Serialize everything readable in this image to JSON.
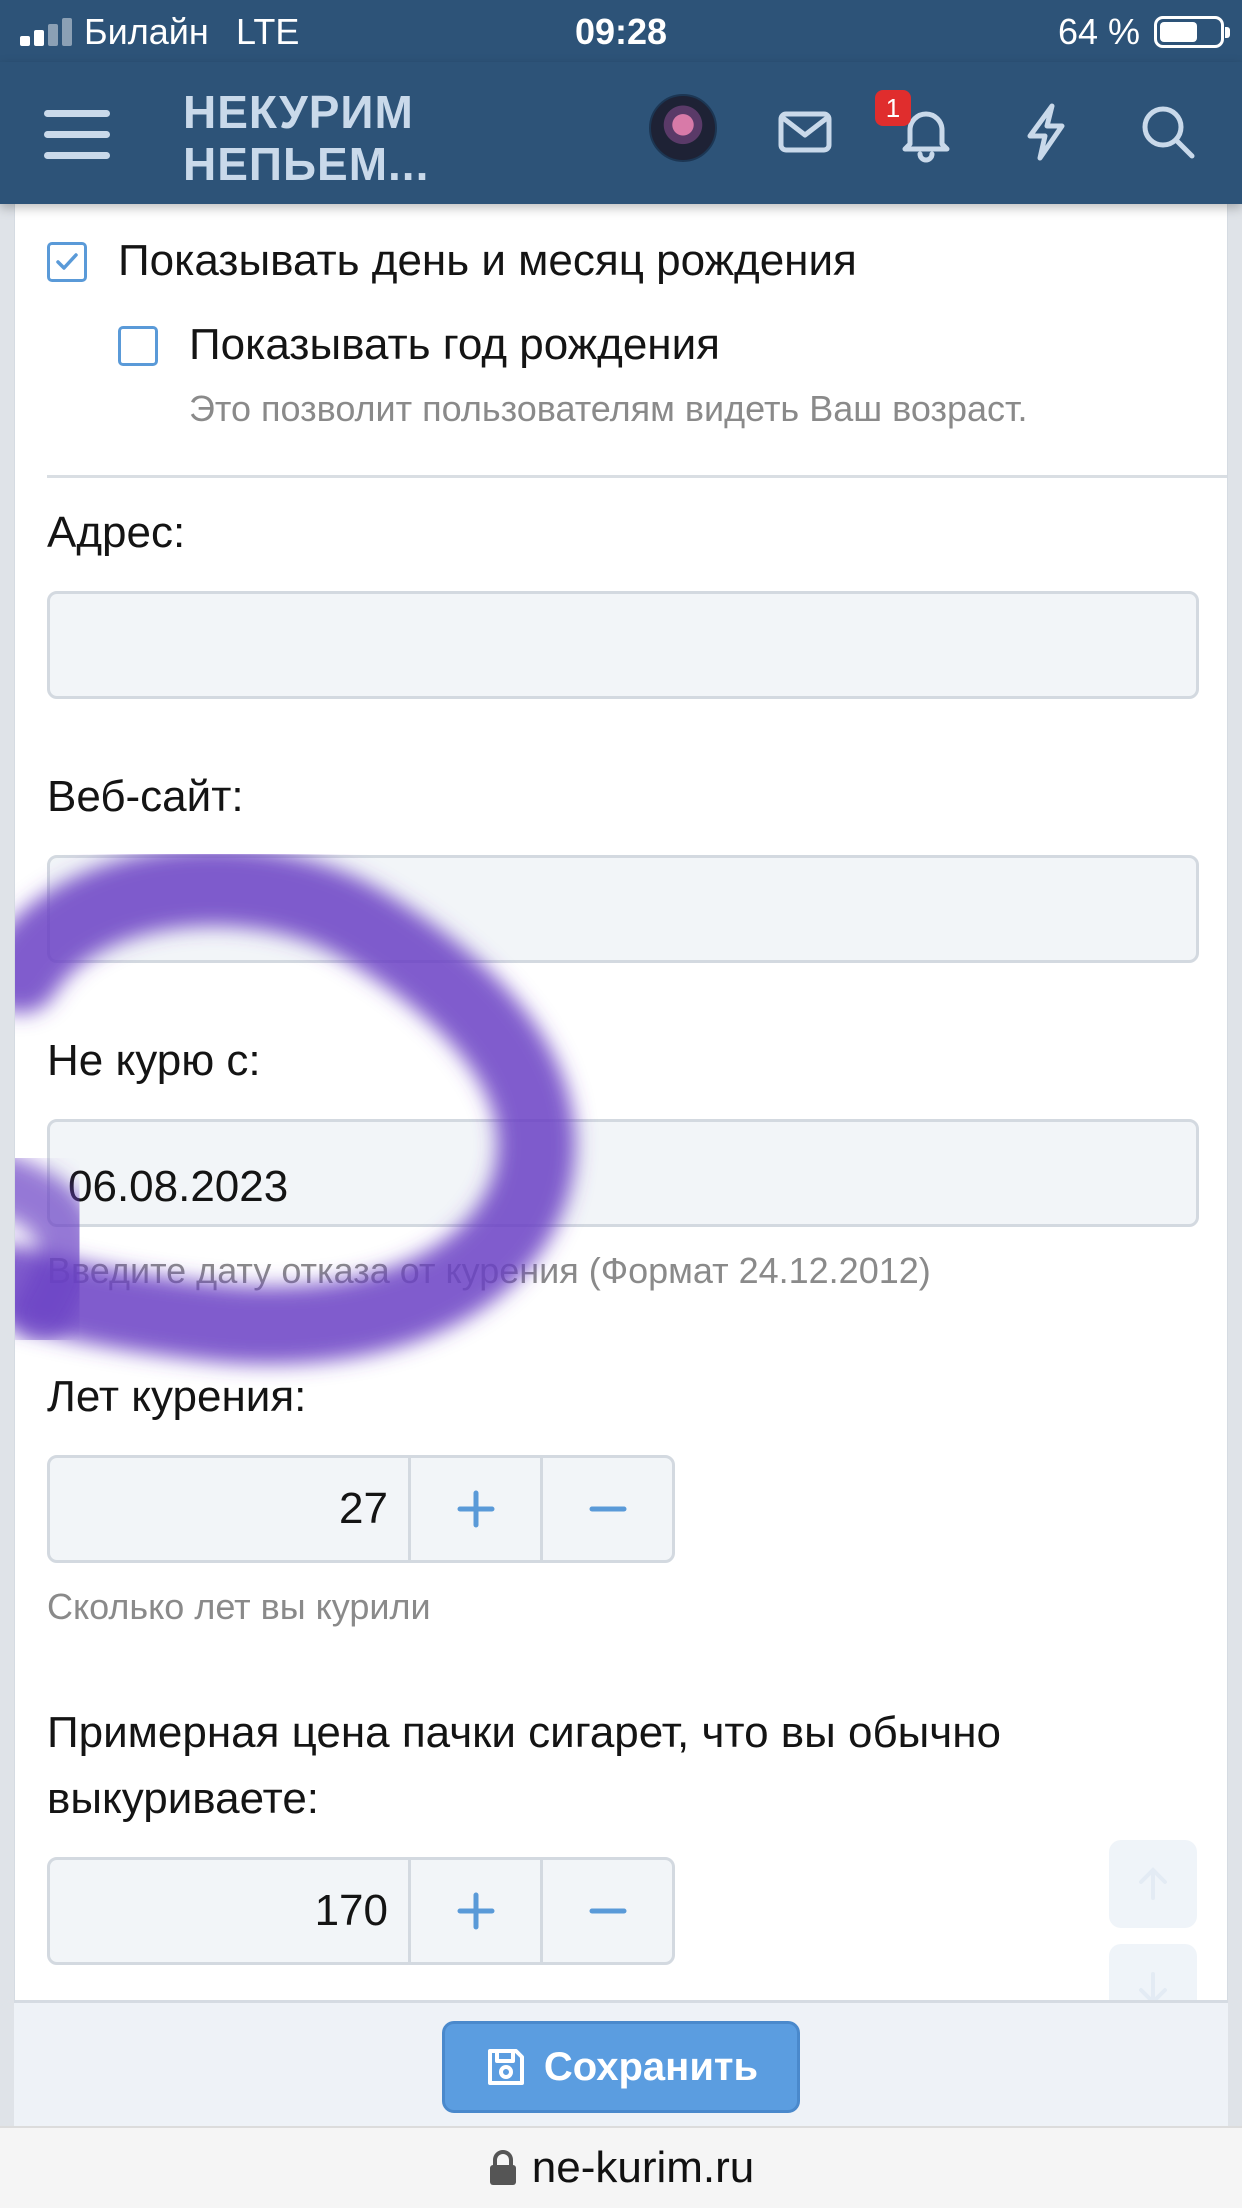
{
  "status_bar": {
    "carrier": "Билайн",
    "network": "LTE",
    "time": "09:28",
    "battery_percent": "64 %",
    "battery_level": 0.64,
    "signal_bars": 2
  },
  "header": {
    "logo_line1": "НЕКУРИМ",
    "logo_line2": "НЕПЬЕМ...",
    "notification_count": "1",
    "colors": {
      "background": "#2d5378",
      "icon": "#c9d9ea",
      "badge": "#e02d2d"
    }
  },
  "form": {
    "show_birthday_label": "Показывать день и месяц рождения",
    "show_birthday_checked": true,
    "show_birth_year_label": "Показывать год рождения",
    "show_birth_year_checked": false,
    "birth_year_hint": "Это позволит пользователям видеть Ваш возраст.",
    "address_label": "Адрес:",
    "address_value": "",
    "website_label": "Веб-сайт:",
    "website_value": "",
    "quit_date_label": "Не курю с:",
    "quit_date_value": "06.08.2023",
    "quit_date_hint": "Введите дату отказа от курения (Формат 24.12.2012)",
    "years_smoking_label": "Лет курения:",
    "years_smoking_value": "27",
    "years_smoking_hint": "Сколько лет вы курили",
    "pack_price_label_line1": "Примерная цена пачки сигарет, что вы обычно",
    "pack_price_label_line2": "выкуриваете:",
    "pack_price_value": "170",
    "accent_color": "#5a9ad8"
  },
  "save_bar": {
    "save_label": "Сохранить",
    "button_color": "#5b9de0"
  },
  "browser": {
    "url": "ne-kurim.ru"
  }
}
